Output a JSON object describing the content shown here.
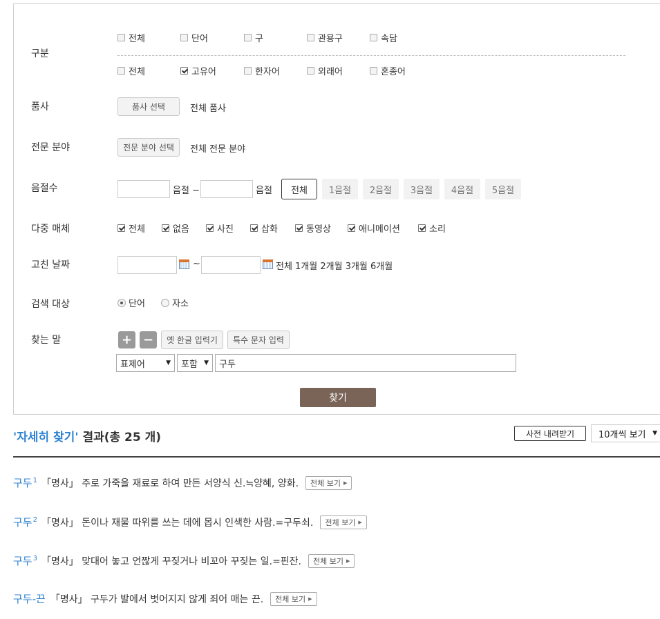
{
  "form": {
    "category": {
      "label": "구분",
      "row1": [
        {
          "label": "전체",
          "checked": false
        },
        {
          "label": "단어",
          "checked": false
        },
        {
          "label": "구",
          "checked": false
        },
        {
          "label": "관용구",
          "checked": false
        },
        {
          "label": "속담",
          "checked": false
        }
      ],
      "row2": [
        {
          "label": "전체",
          "checked": false
        },
        {
          "label": "고유어",
          "checked": true
        },
        {
          "label": "한자어",
          "checked": false
        },
        {
          "label": "외래어",
          "checked": false
        },
        {
          "label": "혼종어",
          "checked": false
        }
      ]
    },
    "pos": {
      "label": "품사",
      "button": "품사 선택",
      "value": "전체 품사"
    },
    "field": {
      "label": "전문 분야",
      "button": "전문 분야 선택",
      "value": "전체 전문 분야"
    },
    "syllables": {
      "label": "음절수",
      "unit1": "음절 ~",
      "unit2": "음절",
      "buttons": [
        {
          "label": "전체",
          "active": true
        },
        {
          "label": "1음절",
          "active": false
        },
        {
          "label": "2음절",
          "active": false
        },
        {
          "label": "3음절",
          "active": false
        },
        {
          "label": "4음절",
          "active": false
        },
        {
          "label": "5음절",
          "active": false
        }
      ]
    },
    "media": {
      "label": "다중 매체",
      "options": [
        {
          "label": "전체",
          "checked": true
        },
        {
          "label": "없음",
          "checked": true
        },
        {
          "label": "사진",
          "checked": true
        },
        {
          "label": "삽화",
          "checked": true
        },
        {
          "label": "동영상",
          "checked": true
        },
        {
          "label": "애니메이션",
          "checked": true
        },
        {
          "label": "소리",
          "checked": true
        }
      ]
    },
    "date": {
      "label": "고친 날짜",
      "tilde": "~",
      "presets": "전체 1개월 2개월 3개월 6개월"
    },
    "target": {
      "label": "검색 대상",
      "options": [
        {
          "label": "단어",
          "selected": true
        },
        {
          "label": "자소",
          "selected": false
        }
      ]
    },
    "keyword": {
      "label": "찾는 말",
      "plus": "+",
      "minus": "−",
      "old_hangul": "옛 한글 입력기",
      "special_chars": "특수 문자 입력",
      "scope": "표제어",
      "match": "포함",
      "value": "구두"
    },
    "submit": "찾기"
  },
  "results": {
    "title_accent": "'자세히 찾기'",
    "title_rest": "결과(총 25 개)",
    "download": "사전 내려받기",
    "per_page": "10개씩 보기",
    "more_label": "전체 보기",
    "entries": [
      {
        "word": "구두",
        "sup": "1",
        "def": "「명사」 주로 가죽을 재료로 하여 만든 서양식 신.≒양혜, 양화."
      },
      {
        "word": "구두",
        "sup": "2",
        "def": "「명사」 돈이나 재물 따위를 쓰는 데에 몹시 인색한 사람.=구두쇠."
      },
      {
        "word": "구두",
        "sup": "3",
        "def": "「명사」 맞대어 놓고 언짢게 꾸짖거나 비꼬아 꾸짖는 일.=핀잔."
      },
      {
        "word": "구두-끈",
        "sup": "",
        "def": "「명사」 구두가 발에서 벗어지지 않게 죄어 매는 끈."
      }
    ]
  }
}
